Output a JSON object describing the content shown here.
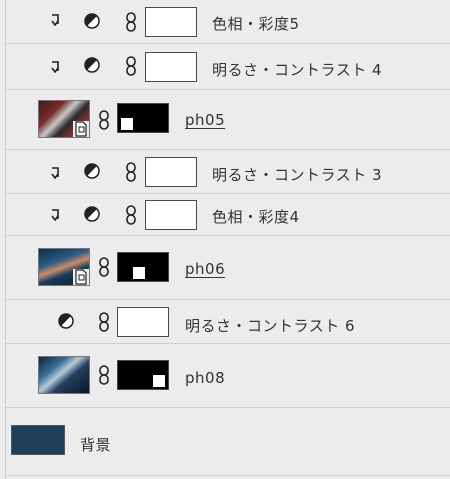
{
  "layers": [
    {
      "name": "色相・彩度5",
      "type": "adjustment-hue",
      "clipped": true
    },
    {
      "name": "明るさ・コントラスト 4",
      "type": "adjustment-brightness",
      "clipped": true
    },
    {
      "name": "ph05",
      "type": "smart-object",
      "underlined": true
    },
    {
      "name": "明るさ・コントラスト 3",
      "type": "adjustment-brightness",
      "clipped": true
    },
    {
      "name": "色相・彩度4",
      "type": "adjustment-hue",
      "clipped": true
    },
    {
      "name": "ph06",
      "type": "smart-object",
      "underlined": true
    },
    {
      "name": "明るさ・コントラスト 6",
      "type": "adjustment-brightness",
      "clipped": false
    },
    {
      "name": "ph08",
      "type": "image"
    },
    {
      "name": "背景",
      "type": "background"
    }
  ],
  "colors": {
    "panel_bg": "#ececec",
    "divider": "#cfcfcf",
    "text": "#333333",
    "background_fill": "#1f3f58"
  }
}
